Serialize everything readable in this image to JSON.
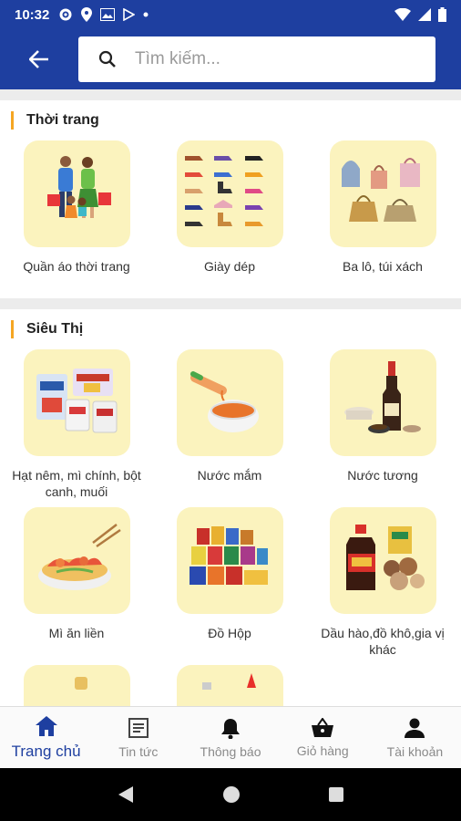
{
  "status": {
    "time": "10:32"
  },
  "search": {
    "placeholder": "Tìm kiếm..."
  },
  "sections": [
    {
      "title": "Thời trang",
      "items": [
        {
          "label": "Quần áo thời trang"
        },
        {
          "label": "Giày dép"
        },
        {
          "label": "Ba lô, túi xách"
        }
      ]
    },
    {
      "title": "Siêu Thị",
      "items": [
        {
          "label": "Hạt nêm, mì chính, bột canh, muối"
        },
        {
          "label": "Nước mắm"
        },
        {
          "label": "Nước tương"
        },
        {
          "label": "Mì ăn liền"
        },
        {
          "label": "Đồ Hộp"
        },
        {
          "label": "Dầu hào,đồ khô,gia vị khác"
        }
      ]
    }
  ],
  "bottom_nav": [
    {
      "label": "Trang chủ",
      "icon": "home-icon",
      "active": true
    },
    {
      "label": "Tin tức",
      "icon": "news-icon"
    },
    {
      "label": "Thông báo",
      "icon": "bell-icon"
    },
    {
      "label": "Giỏ hàng",
      "icon": "basket-icon"
    },
    {
      "label": "Tài khoản",
      "icon": "person-icon"
    }
  ],
  "colors": {
    "primary": "#1e3fa0",
    "accent": "#f5a623",
    "tile": "#fbf3be"
  }
}
